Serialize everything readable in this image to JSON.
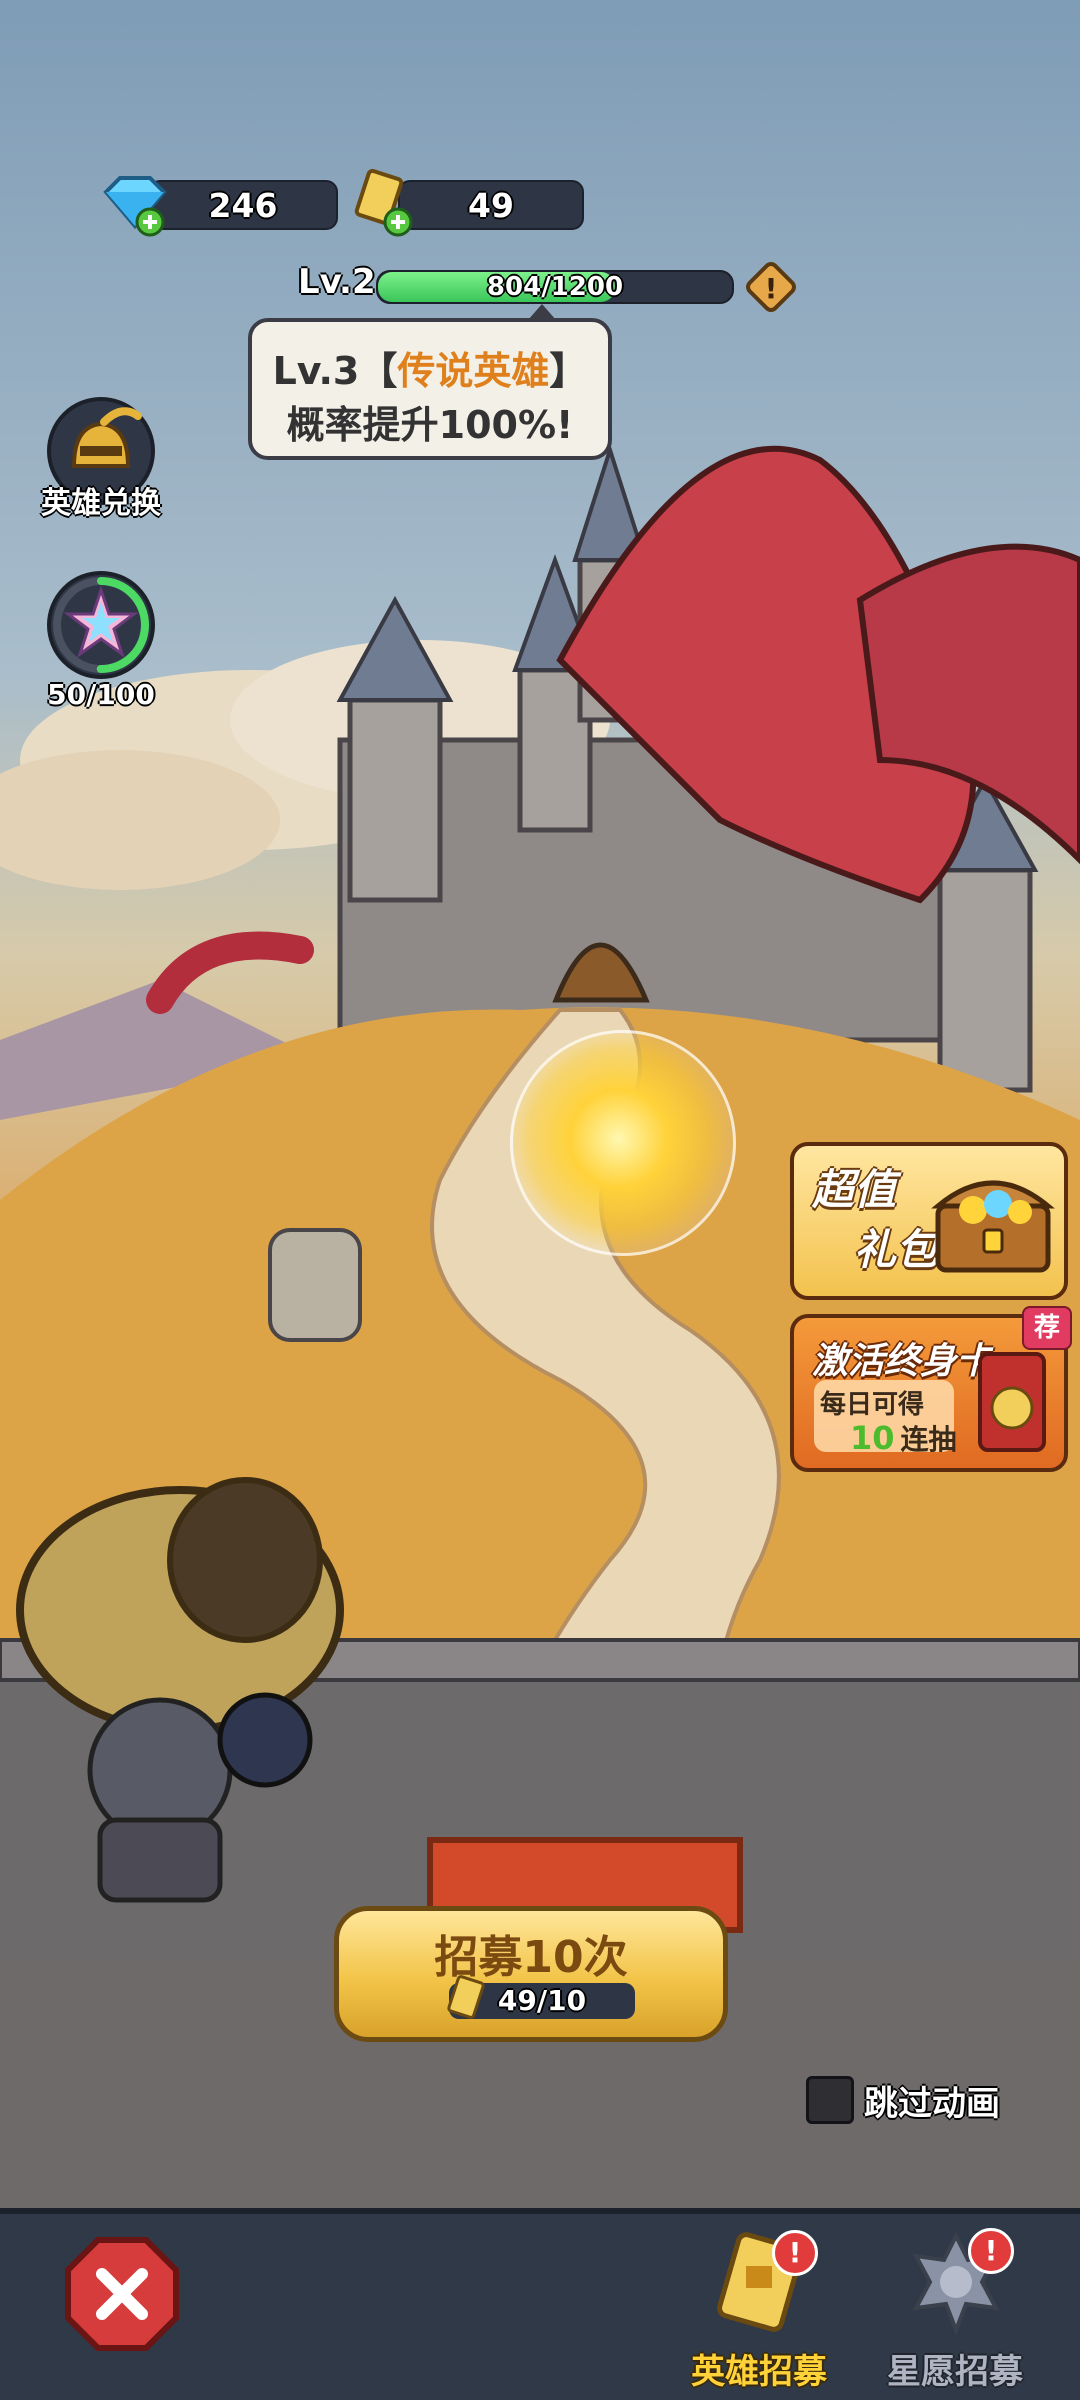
{
  "currency": {
    "gems": "246",
    "tickets": "49"
  },
  "level": {
    "label": "Lv.2",
    "progress_text": "804/1200",
    "progress_fraction": 0.67
  },
  "tip": {
    "line1_prefix": "Lv.3【",
    "line1_highlight": "传说英雄",
    "line1_suffix": "】",
    "line2": "概率提升100%!"
  },
  "left_menu": {
    "hero_exchange_label": "英雄兑换",
    "star_counter": "50/100",
    "star_fraction": 0.5
  },
  "offers": {
    "value_pack": {
      "line1": "超值",
      "line2": "礼包"
    },
    "lifetime_card": {
      "title": "激活终身卡",
      "badge": "荐",
      "line1": "每日可得",
      "count": "10",
      "line2": "连抽"
    }
  },
  "recruit": {
    "button_label": "招募10次",
    "cost": "49/10"
  },
  "skip_animation": {
    "label": "跳过动画",
    "checked": false
  },
  "bottom_nav": {
    "hero_recruit": "英雄招募",
    "star_wish_recruit": "星愿招募",
    "alert_mark": "!"
  },
  "colors": {
    "progress_green": "#4cd964",
    "highlight_orange": "#e0801d",
    "alert_red": "#e23b3b"
  }
}
